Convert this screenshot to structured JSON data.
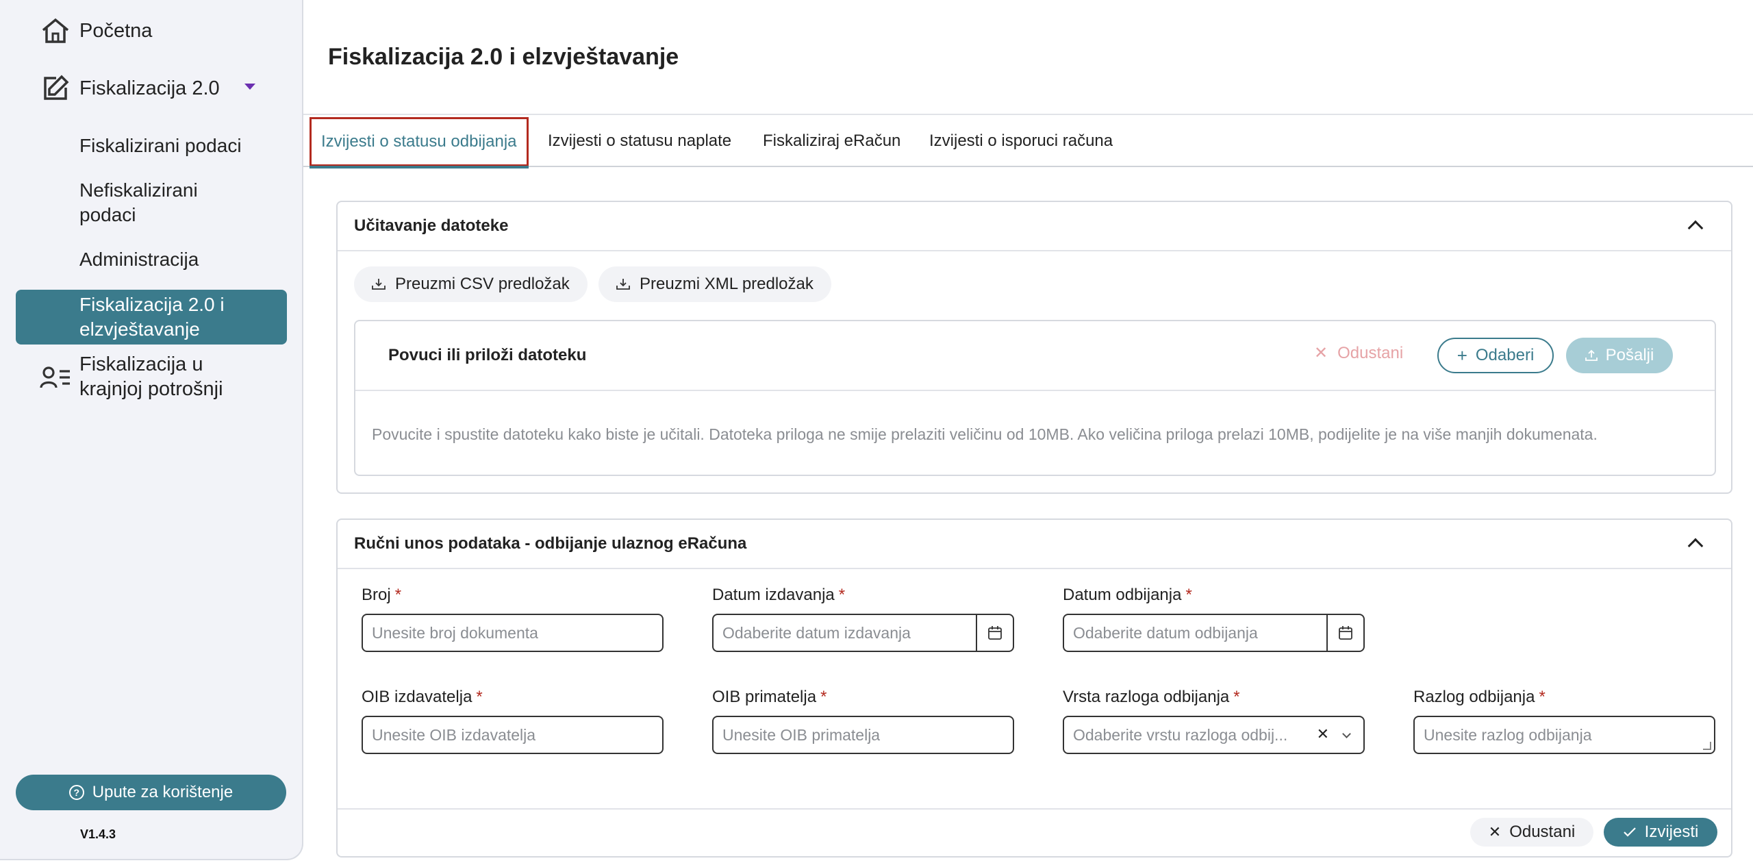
{
  "sidebar": {
    "home": {
      "label": "Početna",
      "icon": "home-icon"
    },
    "fisk2": {
      "label": "Fiskalizacija 2.0",
      "icon": "edit-icon"
    },
    "items": [
      {
        "label": "Fiskalizirani podaci"
      },
      {
        "label": "Nefiskalizirani podaci"
      },
      {
        "label": "Administracija"
      },
      {
        "label": "Fiskalizacija 2.0 i elzvještavanje",
        "active": true
      }
    ],
    "consumer": {
      "label": "Fiskalizacija u krajnjoj potrošnji",
      "icon": "user-list-icon"
    },
    "help_label": "Upute za korištenje",
    "version": "V1.4.3"
  },
  "page": {
    "title": "Fiskalizacija 2.0 i elzvještavanje",
    "tabs": [
      {
        "label": "Izvijesti o statusu odbijanja",
        "active": true
      },
      {
        "label": "Izvijesti o statusu naplate"
      },
      {
        "label": "Fiskaliziraj eRačun"
      },
      {
        "label": "Izvijesti o isporuci računa"
      }
    ]
  },
  "upload": {
    "title": "Učitavanje datoteke",
    "csv_label": "Preuzmi CSV predložak",
    "xml_label": "Preuzmi XML predložak",
    "drop_title": "Povuci ili priloži datoteku",
    "cancel_label": "Odustani",
    "choose_label": "Odaberi",
    "send_label": "Pošalji",
    "hint": "Povucite i spustite datoteku kako biste je učitali. Datoteka priloga ne smije prelaziti veličinu od 10MB. Ako veličina priloga prelazi 10MB, podijelite je na više manjih dokumenata."
  },
  "manual": {
    "title": "Ručni unos podataka - odbijanje ulaznog eRačuna",
    "fields": {
      "broj": {
        "label": "Broj",
        "placeholder": "Unesite broj dokumenta"
      },
      "datum_izdavanja": {
        "label": "Datum izdavanja",
        "placeholder": "Odaberite datum izdavanja"
      },
      "datum_odbijanja": {
        "label": "Datum odbijanja",
        "placeholder": "Odaberite datum odbijanja"
      },
      "oib_izdavatelja": {
        "label": "OIB izdavatelja",
        "placeholder": "Unesite OIB izdavatelja"
      },
      "oib_primatelja": {
        "label": "OIB primatelja",
        "placeholder": "Unesite OIB primatelja"
      },
      "vrsta_razloga": {
        "label": "Vrsta razloga odbijanja",
        "placeholder": "Odaberite vrstu razloga odbij..."
      },
      "razlog": {
        "label": "Razlog odbijanja",
        "placeholder": "Unesite razlog odbijanja"
      }
    },
    "required_mark": "*",
    "cancel_label": "Odustani",
    "submit_label": "Izvijesti"
  },
  "colors": {
    "accent": "#3b7b8c",
    "required": "#b32a1f",
    "highlight": "#b32a1f"
  }
}
